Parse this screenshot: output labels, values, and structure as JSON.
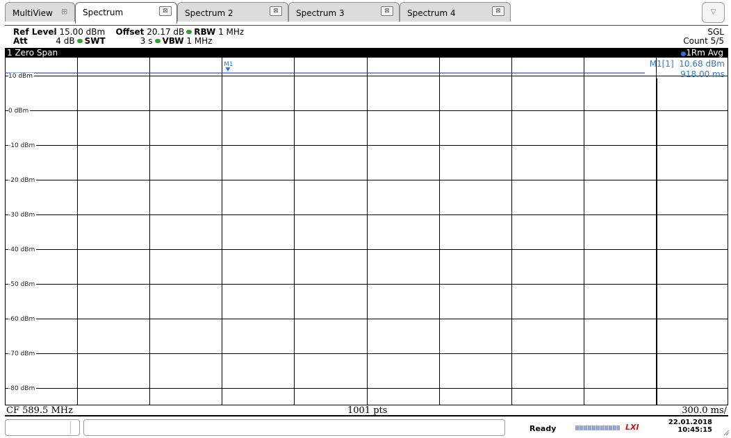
{
  "tabs": [
    {
      "label": "MultiView",
      "active": false
    },
    {
      "label": "Spectrum",
      "active": true
    },
    {
      "label": "Spectrum 2",
      "active": false
    },
    {
      "label": "Spectrum 3",
      "active": false
    },
    {
      "label": "Spectrum 4",
      "active": false
    }
  ],
  "tab_close_glyph": "⊠",
  "dropdown_glyph": "▽",
  "settings": {
    "ref_level_label": "Ref Level",
    "ref_level_value": "15.00 dBm",
    "offset_label": "Offset",
    "offset_value": "20.17 dB",
    "rbw_label": "RBW",
    "rbw_value": "1 MHz",
    "att_label": "Att",
    "att_value": "4 dB",
    "swt_label": "SWT",
    "swt_value": "3 s",
    "vbw_label": "VBW",
    "vbw_value": "1 MHz",
    "sweep_mode": "SGL",
    "count": "Count 5/5"
  },
  "diagram": {
    "title": "1 Zero Span",
    "trace_label": "1Rm Avg",
    "y_labels": [
      "10 dBm",
      "0 dBm",
      "-10 dBm",
      "-20 dBm",
      "-30 dBm",
      "-40 dBm",
      "-50 dBm",
      "-60 dBm",
      "-70 dBm",
      "-80 dBm"
    ],
    "marker_name": "M1",
    "marker_readout_label": "M1[1]",
    "marker_level": "10.68 dBm",
    "marker_time": "918.00 ms",
    "trace_color": "#2b4fd0",
    "marker_color": "#2b7bd0"
  },
  "x_axis": {
    "center": "CF 589.5 MHz",
    "points": "1001 pts",
    "span": "300.0 ms/"
  },
  "status": {
    "state": "Ready",
    "lxi": "LXI",
    "date": "22.01.2018",
    "time": "10:45:15"
  }
}
